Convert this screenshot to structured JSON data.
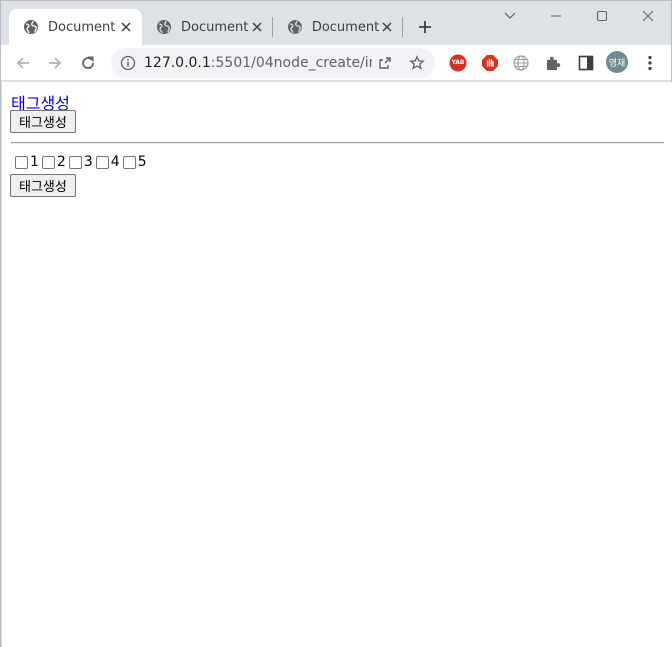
{
  "browser": {
    "tabs": [
      {
        "title": "Document",
        "active": true
      },
      {
        "title": "Document",
        "active": false
      },
      {
        "title": "Document",
        "active": false
      }
    ],
    "url": "127.0.0.1",
    "url_rest": ":5501/04node_create/ind...",
    "profile_label": "영재",
    "ext_yab_label": "YAB"
  },
  "page": {
    "link_text": "태그생성",
    "button1_label": "태그생성",
    "checkboxes": [
      "1",
      "2",
      "3",
      "4",
      "5"
    ],
    "button2_label": "태그생성"
  },
  "colors": {
    "link": "#0000ee",
    "chrome_bg": "#dee1e6",
    "ext_red": "#d93025"
  }
}
